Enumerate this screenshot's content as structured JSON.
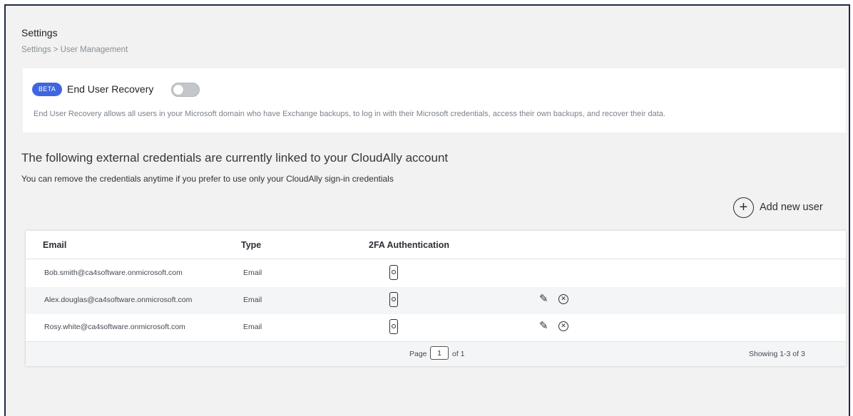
{
  "header": {
    "title": "Settings",
    "breadcrumb": "Settings > User Management"
  },
  "recovery": {
    "badge": "BETA",
    "label": "End User Recovery",
    "toggle_on": false,
    "description": "End User Recovery allows all users in your Microsoft domain who have Exchange backups, to log in with their Microsoft credentials, access their own backups, and recover their data."
  },
  "linked": {
    "heading": "The following external credentials are currently linked to your CloudAlly account",
    "subheading": "You can remove the credentials anytime if you prefer to use only your CloudAlly sign-in credentials"
  },
  "actions": {
    "add_user_label": "Add new user",
    "add_icon": "plus-circle-icon"
  },
  "table": {
    "columns": [
      "Email",
      "Type",
      "2FA Authentication"
    ],
    "rows": [
      {
        "email": "Bob.smith@ca4software.onmicrosoft.com",
        "type": "Email",
        "twofa_icon": "phone-icon",
        "editable": false
      },
      {
        "email": "Alex.douglas@ca4software.onmicrosoft.com",
        "type": "Email",
        "twofa_icon": "phone-icon",
        "editable": true
      },
      {
        "email": "Rosy.white@ca4software.onmicrosoft.com",
        "type": "Email",
        "twofa_icon": "phone-icon",
        "editable": true
      }
    ],
    "pagination": {
      "page_label": "Page",
      "current_page": "1",
      "of_label": "of 1",
      "showing": "Showing 1-3 of 3"
    }
  },
  "colors": {
    "accent": "#3f66e0",
    "background": "#f1f2f1",
    "border": "#1f2a44"
  }
}
